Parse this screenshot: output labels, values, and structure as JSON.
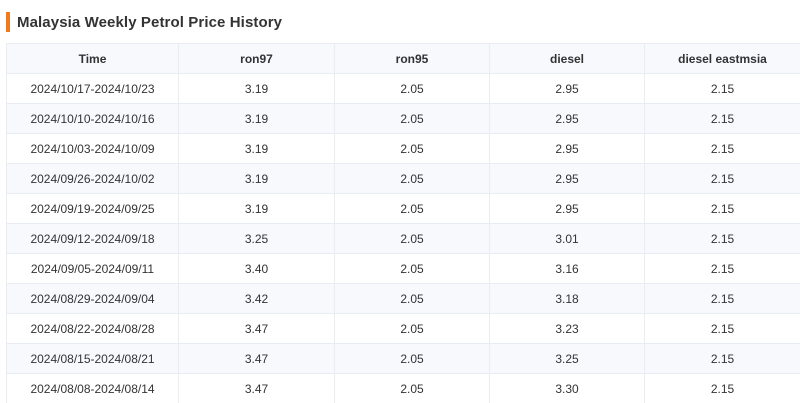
{
  "title": "Malaysia Weekly Petrol Price History",
  "accent_color": "#f07a1c",
  "table": {
    "columns": [
      "Time",
      "ron97",
      "ron95",
      "diesel",
      "diesel eastmsia"
    ],
    "rows": [
      [
        "2024/10/17-2024/10/23",
        "3.19",
        "2.05",
        "2.95",
        "2.15"
      ],
      [
        "2024/10/10-2024/10/16",
        "3.19",
        "2.05",
        "2.95",
        "2.15"
      ],
      [
        "2024/10/03-2024/10/09",
        "3.19",
        "2.05",
        "2.95",
        "2.15"
      ],
      [
        "2024/09/26-2024/10/02",
        "3.19",
        "2.05",
        "2.95",
        "2.15"
      ],
      [
        "2024/09/19-2024/09/25",
        "3.19",
        "2.05",
        "2.95",
        "2.15"
      ],
      [
        "2024/09/12-2024/09/18",
        "3.25",
        "2.05",
        "3.01",
        "2.15"
      ],
      [
        "2024/09/05-2024/09/11",
        "3.40",
        "2.05",
        "3.16",
        "2.15"
      ],
      [
        "2024/08/29-2024/09/04",
        "3.42",
        "2.05",
        "3.18",
        "2.15"
      ],
      [
        "2024/08/22-2024/08/28",
        "3.47",
        "2.05",
        "3.23",
        "2.15"
      ],
      [
        "2024/08/15-2024/08/21",
        "3.47",
        "2.05",
        "3.25",
        "2.15"
      ],
      [
        "2024/08/08-2024/08/14",
        "3.47",
        "2.05",
        "3.30",
        "2.15"
      ]
    ]
  }
}
